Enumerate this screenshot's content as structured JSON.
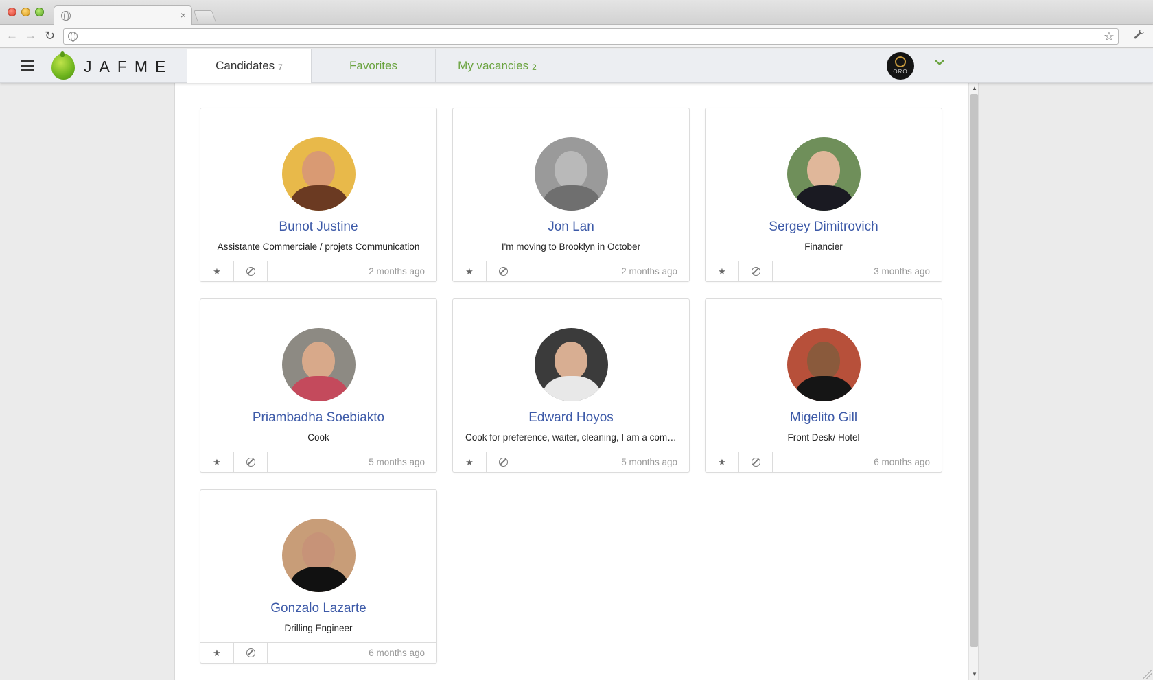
{
  "browser": {
    "tab_close": "×",
    "back_glyph": "←",
    "forward_glyph": "→",
    "reload_glyph": "↻",
    "bookmark_glyph": "☆",
    "wrench_glyph": "🔧"
  },
  "header": {
    "logo_text": "JAFME",
    "tabs": [
      {
        "label": "Candidates",
        "count": "7",
        "active": true
      },
      {
        "label": "Favorites",
        "count": "",
        "active": false
      },
      {
        "label": "My vacancies",
        "count": "2",
        "active": false
      }
    ],
    "user_avatar_text": "ORO",
    "accent_color": "#6aa33f"
  },
  "candidates": [
    {
      "name": "Bunot Justine",
      "subtitle": "Assistante Commerciale / projets Communication",
      "time": "2 months ago",
      "avatar_bg": "#e8b94a",
      "avatar_head": "#d99a73",
      "avatar_body": "#6b3a22"
    },
    {
      "name": "Jon Lan",
      "subtitle": "I'm moving to Brooklyn in October",
      "time": "2 months ago",
      "avatar_bg": "#9a9a9a",
      "avatar_head": "#b9b9b9",
      "avatar_body": "#6f6f6f"
    },
    {
      "name": "Sergey Dimitrovich",
      "subtitle": "Financier",
      "time": "3 months ago",
      "avatar_bg": "#6f8f5a",
      "avatar_head": "#e0b79a",
      "avatar_body": "#1a1a22"
    },
    {
      "name": "Priambadha Soebiakto",
      "subtitle": "Cook",
      "time": "5 months ago",
      "avatar_bg": "#8d8a83",
      "avatar_head": "#d8a98a",
      "avatar_body": "#c44a5c"
    },
    {
      "name": "Edward Hoyos",
      "subtitle": "Cook for preference, waiter, cleaning, I am a comp...",
      "time": "5 months ago",
      "avatar_bg": "#3b3b3b",
      "avatar_head": "#d8ae92",
      "avatar_body": "#e8e8e8"
    },
    {
      "name": "Migelito Gill",
      "subtitle": "Front Desk/ Hotel",
      "time": "6 months ago",
      "avatar_bg": "#b7503a",
      "avatar_head": "#8a5a3c",
      "avatar_body": "#151515"
    },
    {
      "name": "Gonzalo Lazarte",
      "subtitle": "Drilling Engineer",
      "time": "6 months ago",
      "avatar_bg": "#c89d78",
      "avatar_head": "#c79378",
      "avatar_body": "#111111"
    }
  ],
  "icons": {
    "favorite": "★",
    "block": "block-icon"
  }
}
